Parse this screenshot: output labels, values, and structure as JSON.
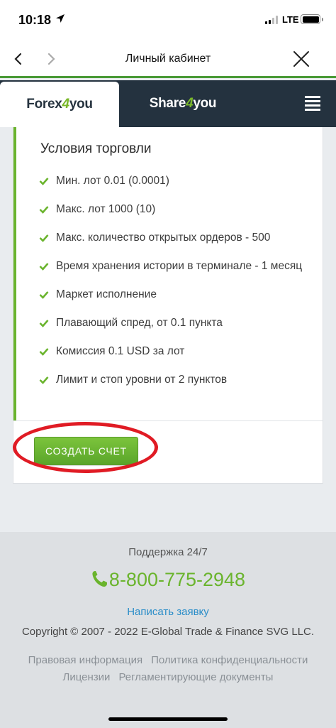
{
  "status_bar": {
    "time": "10:18",
    "network": "LTE"
  },
  "browser": {
    "title": "Личный кабинет"
  },
  "tabs": {
    "forex": {
      "main": "Forex",
      "num": "4",
      "suffix": "you"
    },
    "share": {
      "main": "Share",
      "num": "4",
      "suffix": "you"
    }
  },
  "conditions": {
    "title": "Условия торговли",
    "items": [
      "Мин. лот 0.01 (0.0001)",
      "Макс. лот 1000 (10)",
      "Макс. количество открытых ордеров - 500",
      "Время хранения истории в терминале - 1 месяц",
      "Маркет исполнение",
      "Плавающий спред, от 0.1 пункта",
      "Комиссия 0.1 USD за лот",
      "Лимит и стоп уровни от 2 пунктов"
    ]
  },
  "create_button": {
    "label": "СОЗДАТЬ СЧЕТ"
  },
  "footer": {
    "support": "Поддержка 24/7",
    "phone": "8-800-775-2948",
    "request_link": "Написать заявку",
    "copyright": "Copyright © 2007 - 2022 E-Global Trade & Finance SVG LLC.",
    "links": [
      "Правовая информация",
      "Политика конфиденциальности",
      "Лицензии",
      "Регламентирующие документы"
    ]
  },
  "colors": {
    "accent_green": "#6ab42d",
    "header_dark": "#24323f",
    "link_blue": "#2a8dc8",
    "highlight_red": "#e01b24"
  }
}
